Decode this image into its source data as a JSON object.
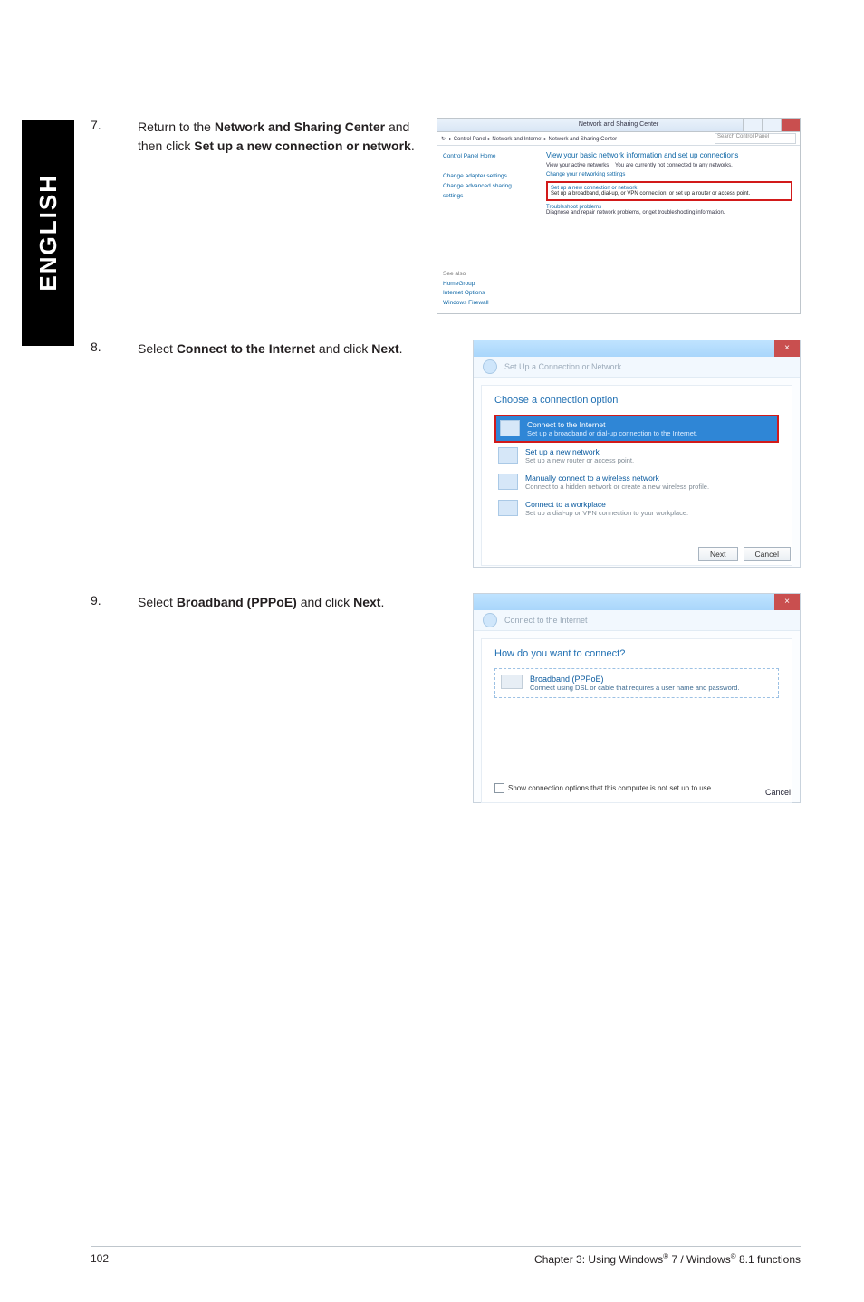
{
  "lang_tab": "ENGLISH",
  "steps": {
    "s7": {
      "num": "7.",
      "pre": "Return to the ",
      "b1": "Network and Sharing Center",
      "mid": " and then click ",
      "b2": "Set up a new connection or network",
      "post": "."
    },
    "s8": {
      "num": "8.",
      "pre": "Select ",
      "b1": "Connect to the Internet",
      "mid": " and click ",
      "b2": "Next",
      "post": "."
    },
    "s9": {
      "num": "9.",
      "pre": "Select ",
      "b1": "Broadband (PPPoE)",
      "mid": " and click ",
      "b2": "Next",
      "post": "."
    }
  },
  "shot1": {
    "title": "Network and Sharing Center",
    "breadcrumb": "▸ Control Panel ▸ Network and Internet ▸ Network and Sharing Center",
    "search_placeholder": "Search Control Panel",
    "side": {
      "home": "Control Panel Home",
      "l1": "Change adapter settings",
      "l2": "Change advanced sharing settings"
    },
    "main": {
      "headline": "View your basic network information and set up connections",
      "row1a": "View your active networks",
      "row1b": "You are currently not connected to any networks.",
      "row2": "Change your networking settings",
      "opt1_t": "Set up a new connection or network",
      "opt1_d": "Set up a broadband, dial-up, or VPN connection; or set up a router or access point.",
      "opt2_t": "Troubleshoot problems",
      "opt2_d": "Diagnose and repair network problems, or get troubleshooting information."
    },
    "seealso": {
      "label": "See also",
      "l1": "HomeGroup",
      "l2": "Internet Options",
      "l3": "Windows Firewall"
    }
  },
  "shot2": {
    "header": "Set Up a Connection or Network",
    "title": "Choose a connection option",
    "opt_sel_t": "Connect to the Internet",
    "opt_sel_d": "Set up a broadband or dial-up connection to the Internet.",
    "opt2_t": "Set up a new network",
    "opt2_d": "Set up a new router or access point.",
    "opt3_t": "Manually connect to a wireless network",
    "opt3_d": "Connect to a hidden network or create a new wireless profile.",
    "opt4_t": "Connect to a workplace",
    "opt4_d": "Set up a dial-up or VPN connection to your workplace.",
    "btn_next": "Next",
    "btn_cancel": "Cancel"
  },
  "shot3": {
    "header": "Connect to the Internet",
    "title": "How do you want to connect?",
    "opt_t": "Broadband (PPPoE)",
    "opt_d": "Connect using DSL or cable that requires a user name and password.",
    "showopts": "Show connection options that this computer is not set up to use",
    "btn_cancel": "Cancel"
  },
  "footer": {
    "page": "102",
    "chapter_a": "Chapter 3: Using Windows",
    "reg": "®",
    "chapter_b": " 7 / Windows",
    "chapter_c": " 8.1 functions"
  }
}
